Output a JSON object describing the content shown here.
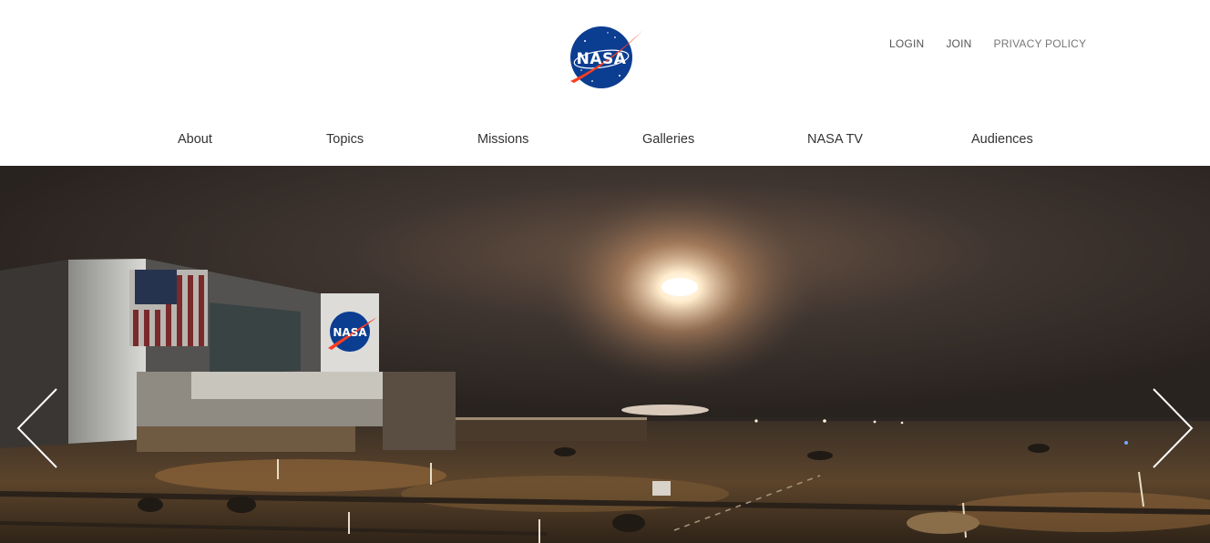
{
  "header": {
    "logo": {
      "icon": "nasa-meatball-logo",
      "text": "NASA"
    },
    "utility_links": [
      {
        "label": "LOGIN"
      },
      {
        "label": "JOIN"
      },
      {
        "label": "PRIVACY POLICY"
      }
    ]
  },
  "nav": {
    "items": [
      {
        "label": "About"
      },
      {
        "label": "Topics"
      },
      {
        "label": "Missions"
      },
      {
        "label": "Galleries"
      },
      {
        "label": "NASA TV"
      },
      {
        "label": "Audiences"
      }
    ]
  },
  "hero": {
    "image": "night-rocket-launch-over-vehicle-assembly-building",
    "building_logo_text": "NASA",
    "prev_icon": "chevron-left-icon",
    "next_icon": "chevron-right-icon"
  },
  "colors": {
    "nasa_blue": "#0b3d91",
    "nasa_red": "#fc3d21",
    "nav_text": "#333333",
    "utility_text": "#555555"
  }
}
